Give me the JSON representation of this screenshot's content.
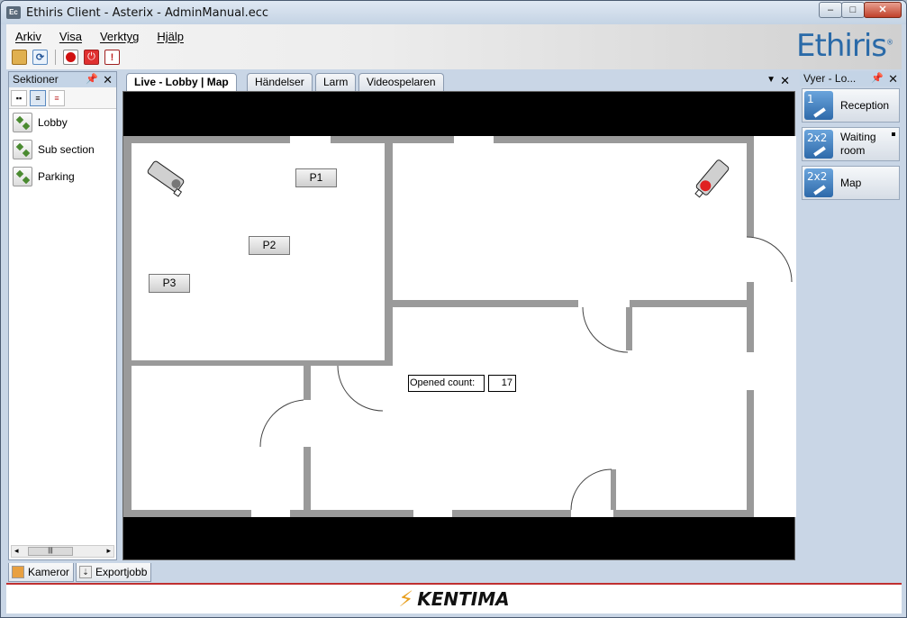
{
  "window": {
    "icon_text": "Ec",
    "title": "Ethiris Client - Asterix - AdminManual.ecc",
    "min": "–",
    "max": "□",
    "close": "✕"
  },
  "menu": [
    "Arkiv",
    "Visa",
    "Verktyg",
    "Hjälp"
  ],
  "brand": "Ethiris",
  "left_panel": {
    "title": "Sektioner",
    "items": [
      "Lobby",
      "Sub section",
      "Parking"
    ]
  },
  "tabs": [
    "Live - Lobby | Map",
    "Händelser",
    "Larm",
    "Videospelaren"
  ],
  "map": {
    "presets": [
      "P1",
      "P2",
      "P3"
    ],
    "counter_label": "Opened count:",
    "counter_value": "17"
  },
  "right_panel": {
    "title": "Vyer - Lo...",
    "views": [
      {
        "icon": "1",
        "label": "Reception"
      },
      {
        "icon": "2x2",
        "label": "Waiting room"
      },
      {
        "icon": "2x2",
        "label": "Map"
      }
    ]
  },
  "bottom_tabs": [
    "Kameror",
    "Exportjobb"
  ],
  "footer": {
    "logo_text": "KENTIMA"
  },
  "colors": {
    "accent": "#2a6aa8",
    "footer_line": "#c03030",
    "camera_alarm": "#e02020"
  }
}
